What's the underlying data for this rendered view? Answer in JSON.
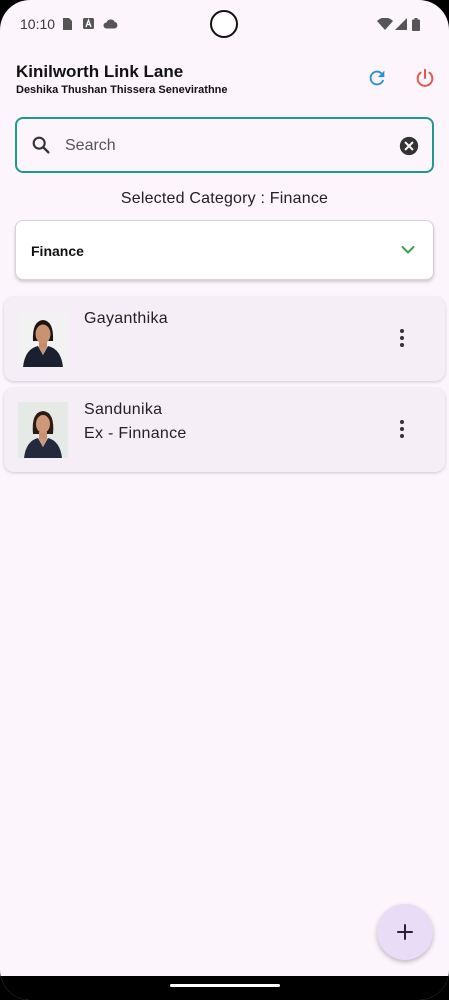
{
  "status_bar": {
    "time": "10:10",
    "left_icons": [
      "sim-card-icon",
      "text-a-icon",
      "cloud-icon"
    ],
    "right_icons": [
      "wifi-icon",
      "signal-icon",
      "battery-icon"
    ]
  },
  "header": {
    "title": "Kinilworth Link Lane",
    "subtitle": "Deshika Thushan Thissera Senevirathne",
    "refresh_icon": "refresh-icon",
    "power_icon": "power-icon"
  },
  "search": {
    "placeholder": "Search",
    "value": ""
  },
  "category": {
    "selected_label": "Selected Category : Finance",
    "dropdown_value": "Finance"
  },
  "people": [
    {
      "name": "Gayanthika",
      "role": ""
    },
    {
      "name": "Sandunika",
      "role": "Ex - Finnance"
    }
  ],
  "fab": {
    "label": "+"
  },
  "colors": {
    "accent": "#1f9a8d",
    "refresh": "#2b8fd6",
    "power": "#e0584f",
    "chevron": "#3aa24a",
    "background": "#fcf5fb",
    "card": "#f5eef6",
    "fab": "#e8dcf7"
  }
}
